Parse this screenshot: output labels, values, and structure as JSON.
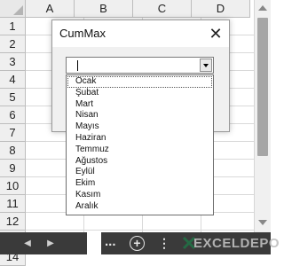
{
  "sheet": {
    "columns": [
      "A",
      "B",
      "C",
      "D"
    ],
    "rows": [
      "1",
      "2",
      "3",
      "4",
      "5",
      "6",
      "7",
      "8",
      "9",
      "10",
      "11",
      "12",
      "13",
      "14"
    ]
  },
  "dialog": {
    "title": "CumMax",
    "close_glyph": "✕",
    "combo_value": "",
    "options": [
      "Ocak",
      "Şubat",
      "Mart",
      "Nisan",
      "Mayıs",
      "Haziran",
      "Temmuz",
      "Ağustos",
      "Eylül",
      "Ekim",
      "Kasım",
      "Aralık"
    ],
    "selected_index": 0
  },
  "sheetbar": {
    "prev_glyph": "◀",
    "next_glyph": "▶",
    "more_tabs": "...",
    "add_sheet": "+",
    "options_glyph": "⋮",
    "logo_text": "EXCELDEPO"
  },
  "colors": {
    "accent": "#217346",
    "sheetbar_bg": "#3a3a3a"
  }
}
